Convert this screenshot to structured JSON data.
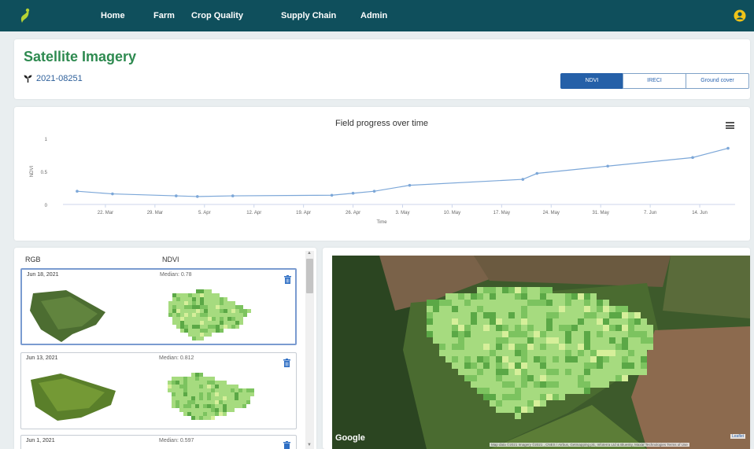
{
  "nav": {
    "logo_icon": "leaf-logo-icon",
    "items": [
      "Home",
      "Farm",
      "Crop Quality",
      "Supply Chain",
      "Admin"
    ],
    "user_icon": "user-icon",
    "bg": "#0f4f5c",
    "logo_color": "#b5d334"
  },
  "header": {
    "title": "Satellite Imagery",
    "field_icon": "seedling-icon",
    "field_id": "2021-08251",
    "indices": [
      "NDVI",
      "IRECI",
      "Ground cover"
    ],
    "active_index": "NDVI"
  },
  "chart_data": {
    "type": "line",
    "title": "Field progress over time",
    "xlabel": "Time",
    "ylabel": "NDVI",
    "ylim": [
      0,
      1
    ],
    "yticks": [
      "1",
      "0.5",
      "0"
    ],
    "xticks": [
      "22. Mar",
      "29. Mar",
      "5. Apr",
      "12. Apr",
      "19. Apr",
      "26. Apr",
      "3. May",
      "10. May",
      "17. May",
      "24. May",
      "31. May",
      "7. Jun",
      "14. Jun"
    ],
    "series": [
      {
        "x": [
          "2021-03-18",
          "2021-03-23",
          "2021-04-01",
          "2021-04-04",
          "2021-04-09",
          "2021-04-23",
          "2021-04-26",
          "2021-04-29",
          "2021-05-04",
          "2021-05-20",
          "2021-05-22",
          "2021-06-01",
          "2021-06-13",
          "2021-06-18"
        ],
        "values": [
          0.2,
          0.16,
          0.13,
          0.12,
          0.13,
          0.14,
          0.17,
          0.2,
          0.29,
          0.38,
          0.47,
          0.58,
          0.71,
          0.85
        ]
      }
    ],
    "line_color": "#7ca7d8",
    "grid": false,
    "menu_icon": "hamburger-menu-icon"
  },
  "list": {
    "col_rgb": "RGB",
    "col_ndvi": "NDVI",
    "items": [
      {
        "date": "Jun 18, 2021",
        "median_label": "Median:",
        "median": "0.78",
        "selected": true
      },
      {
        "date": "Jun 13, 2021",
        "median_label": "Median:",
        "median": "0.812",
        "selected": false
      },
      {
        "date": "Jun 1, 2021",
        "median_label": "Median:",
        "median": "0.597",
        "selected": false
      }
    ],
    "trash_icon": "trash-icon",
    "ndvi_colors": [
      "#a6db7f",
      "#7cc35f",
      "#5ba846",
      "#d6ef9a"
    ]
  },
  "map": {
    "google": "Google",
    "attribution": "Map data ©2021 Imagery ©2021 , CNES / Airbus, Getmapping plc, Infoterra Ltd & Bluesky, Maxar Technologies   Terms of Use",
    "leaflet": "Leaflet"
  }
}
